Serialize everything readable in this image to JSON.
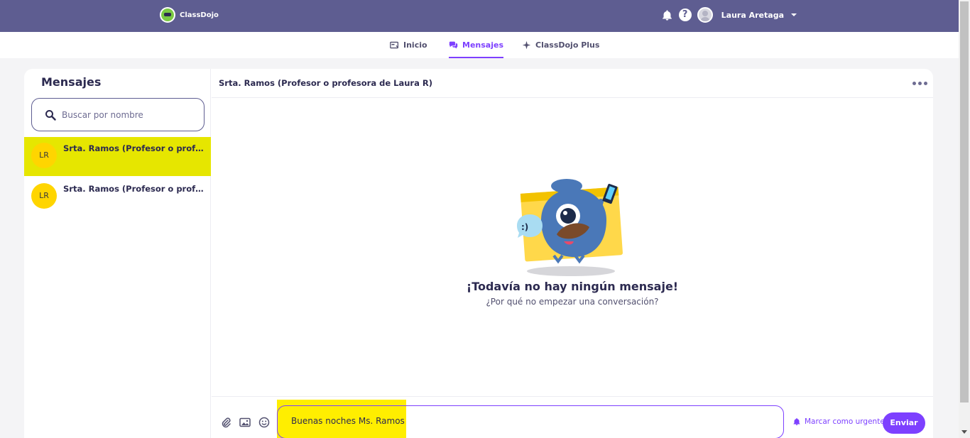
{
  "topbar": {
    "brand": "ClassDojo",
    "user_name": "Laura Aretaga",
    "icons": [
      "bell-icon",
      "help-icon",
      "avatar",
      "caret-down-icon"
    ],
    "color": "#5e5d91"
  },
  "nav": {
    "tabs": [
      {
        "label": "Inicio",
        "icon": "home-icon",
        "active": false
      },
      {
        "label": "Mensajes",
        "icon": "chat-icon",
        "active": true
      },
      {
        "label": "ClassDojo Plus",
        "icon": "sparkle-icon",
        "active": false
      }
    ],
    "accent": "#7d40ff"
  },
  "sidebar": {
    "title": "Mensajes",
    "search_placeholder": "Buscar por nombre",
    "conversations": [
      {
        "initials": "LR",
        "name": "Srta. Ramos (Profesor o profesora de Laura R)",
        "highlighted": true
      },
      {
        "initials": "LR",
        "name": "Srta. Ramos (Profesor o profesora de Laura R)",
        "highlighted": false
      }
    ]
  },
  "chat": {
    "title": "Srta. Ramos (Profesor o profesora de Laura R)",
    "empty_title": "¡Todavía no hay ningún mensaje!",
    "empty_subtitle": "¿Por qué no empezar una conversación?",
    "composer": {
      "message": "Buenas noches Ms. Ramos",
      "urgent_label": "Marcar como urgente",
      "send_label": "Enviar",
      "tools": [
        "attach-icon",
        "image-icon",
        "emoji-icon"
      ]
    }
  }
}
